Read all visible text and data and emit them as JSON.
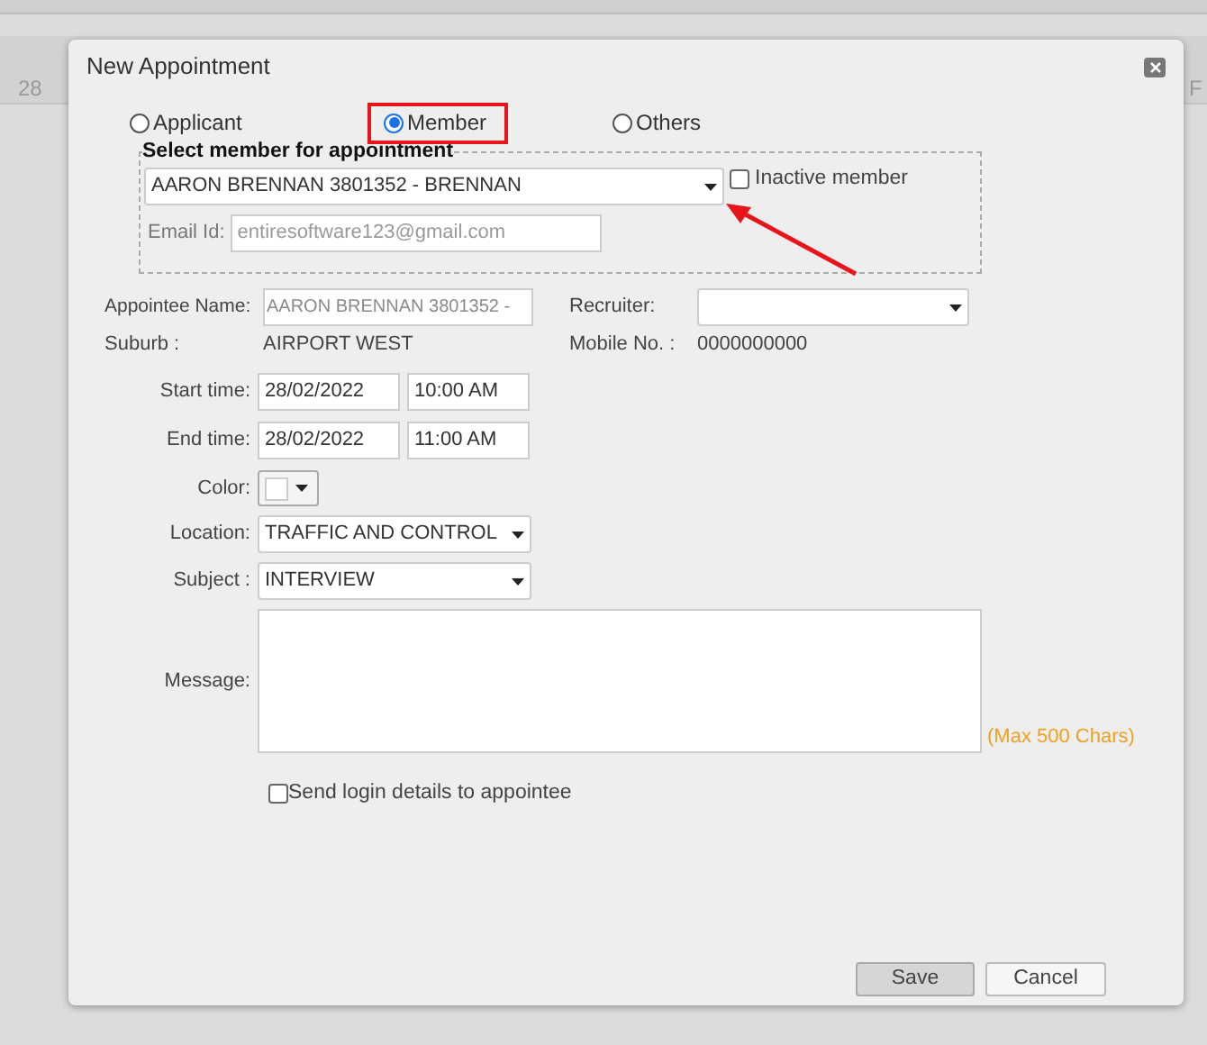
{
  "background": {
    "day_labels": [
      "28",
      "F"
    ]
  },
  "dialog": {
    "title": "New Appointment",
    "type_options": [
      {
        "label": "Applicant",
        "selected": false
      },
      {
        "label": "Member",
        "selected": true
      },
      {
        "label": "Others",
        "selected": false
      }
    ],
    "member_group": {
      "title": "Select member for appointment",
      "member": "AARON BRENNAN 3801352 - BRENNAN",
      "inactive_member": {
        "label": "Inactive member",
        "checked": false
      },
      "email_label": "Email Id:",
      "email_value": "entiresoftware123@gmail.com"
    },
    "appointee_name": {
      "label": "Appointee Name:",
      "value": "AARON BRENNAN 3801352 -"
    },
    "recruiter": {
      "label": "Recruiter:"
    },
    "suburb": {
      "label": "Suburb :",
      "value": "AIRPORT WEST"
    },
    "mobile": {
      "label": "Mobile No. :",
      "value": "0000000000"
    },
    "start_time": {
      "label": "Start time:",
      "date": "28/02/2022",
      "time": "10:00 AM"
    },
    "end_time": {
      "label": "End time:",
      "date": "28/02/2022",
      "time": "11:00 AM"
    },
    "color": {
      "label": "Color:",
      "color": "#ffffff"
    },
    "location": {
      "label": "Location:",
      "value": "TRAFFIC AND CONTROL"
    },
    "subject": {
      "label": "Subject :",
      "value": "INTERVIEW"
    },
    "message": {
      "label": "Message:",
      "note": "(Max 500 Chars)"
    },
    "send_login": {
      "label": "Send login details to appointee",
      "checked": false
    },
    "buttons": [
      "Save",
      "Cancel"
    ]
  }
}
